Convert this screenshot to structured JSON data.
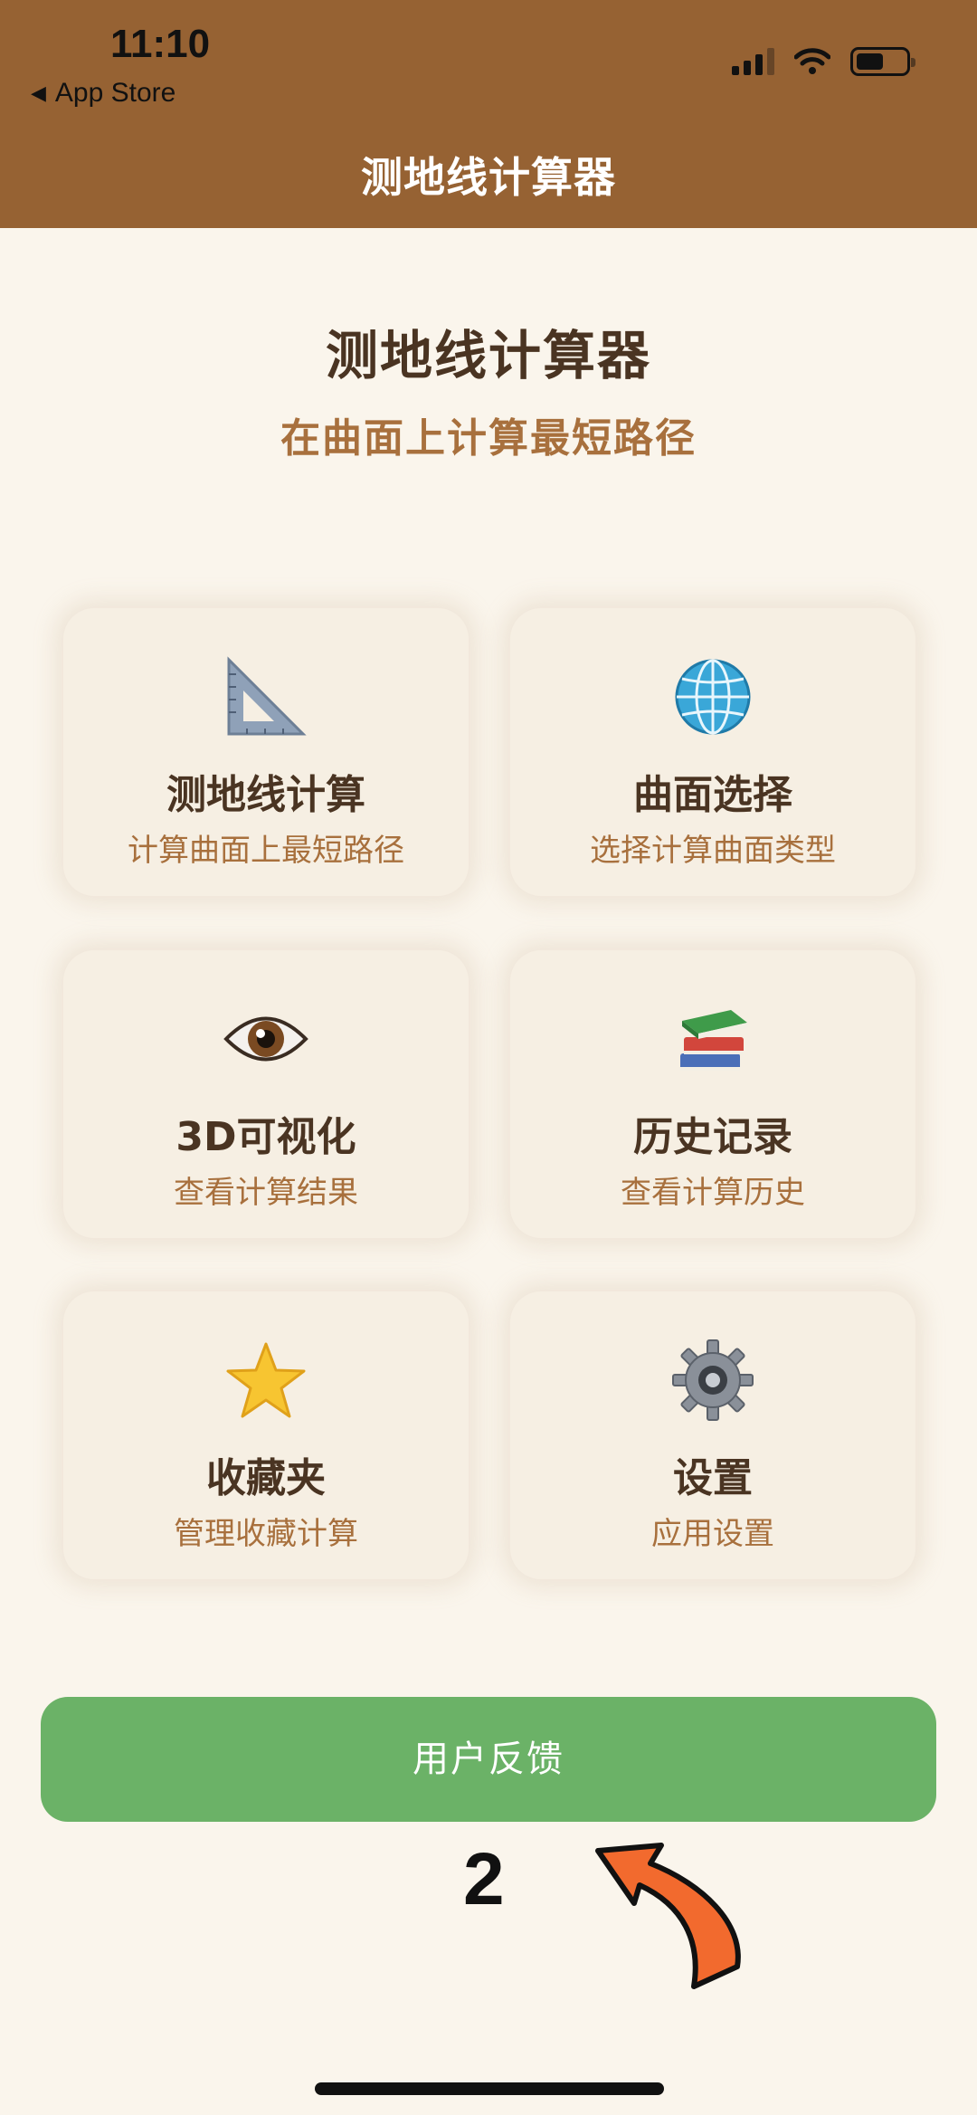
{
  "status_bar": {
    "time": "11:10",
    "back_label": "App Store"
  },
  "nav": {
    "title": "测地线计算器"
  },
  "hero": {
    "title": "测地线计算器",
    "subtitle": "在曲面上计算最短路径"
  },
  "cards": [
    {
      "icon": "triangle-ruler-icon",
      "label": "测地线计算",
      "desc": "计算曲面上最短路径"
    },
    {
      "icon": "globe-icon",
      "label": "曲面选择",
      "desc": "选择计算曲面类型"
    },
    {
      "icon": "eye-icon",
      "label": "3D可视化",
      "desc": "查看计算结果"
    },
    {
      "icon": "books-icon",
      "label": "历史记录",
      "desc": "查看计算历史"
    },
    {
      "icon": "star-icon",
      "label": "收藏夹",
      "desc": "管理收藏计算"
    },
    {
      "icon": "gear-icon",
      "label": "设置",
      "desc": "应用设置"
    }
  ],
  "feedback_button": {
    "label": "用户反馈"
  },
  "annotation": {
    "step": "2",
    "arrow_color": "#f26a2e"
  },
  "colors": {
    "header": "#966233",
    "background": "#faf5ec",
    "card": "#f6efe3",
    "primary_text": "#4a3422",
    "accent_text": "#a8703d",
    "button": "#6bb267"
  }
}
